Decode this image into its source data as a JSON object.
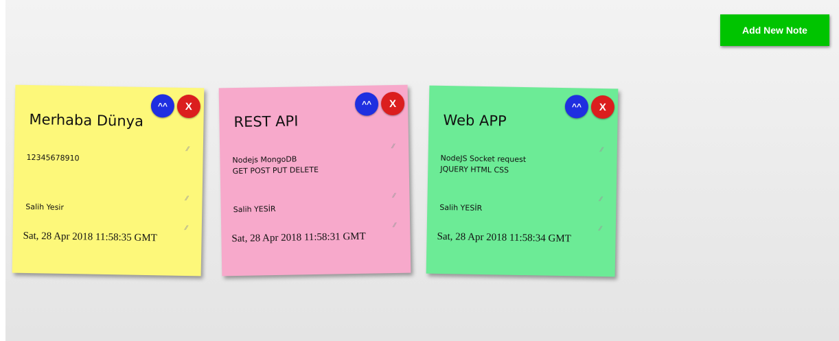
{
  "toolbar": {
    "add_label": "Add New Note"
  },
  "note_actions": {
    "up_label": "^^",
    "close_label": "X"
  },
  "notes": [
    {
      "title": "Merhaba Dünya",
      "body": "12345678910",
      "author": "Salih Yesir",
      "date": "Sat, 28 Apr 2018 11:58:35 GMT",
      "color": "#fdf87a"
    },
    {
      "title": "REST API",
      "body": "Nodejs MongoDB\nGET POST PUT DELETE",
      "author": "Salih YESİR",
      "date": "Sat, 28 Apr 2018 11:58:31 GMT",
      "color": "#f7a9cb"
    },
    {
      "title": "Web APP",
      "body": "NodeJS Socket request\nJQUERY HTML CSS",
      "author": "Salih YESİR",
      "date": "Sat, 28 Apr 2018 11:58:34 GMT",
      "color": "#6ceb96"
    }
  ],
  "colors": {
    "add_button": "#00c400",
    "up_button": "#1f2fe0",
    "close_button": "#db1e1e"
  },
  "icons": {
    "resize": "resize-grip-icon"
  }
}
